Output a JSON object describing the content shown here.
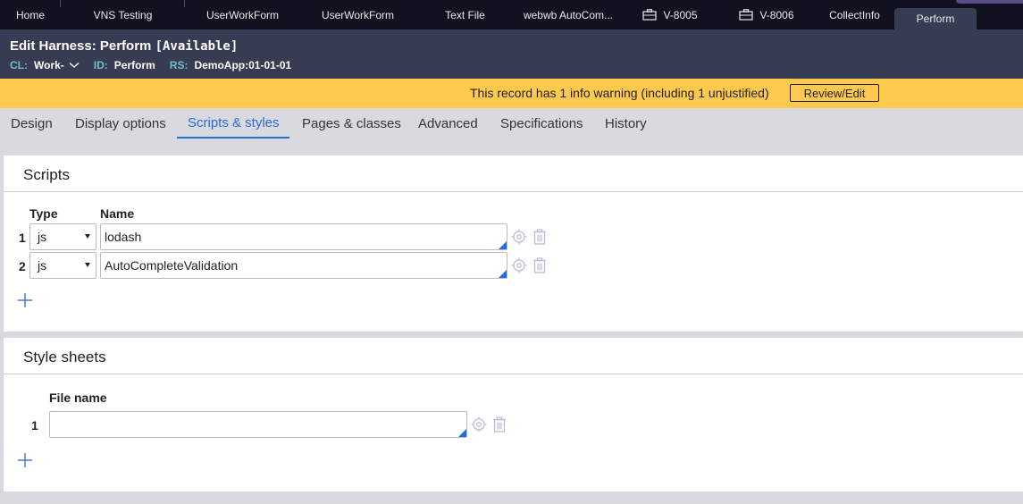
{
  "top_tabs": [
    {
      "label": "Home"
    },
    {
      "label": "VNS Testing"
    },
    {
      "label": "UserWorkForm"
    },
    {
      "label": "UserWorkForm"
    },
    {
      "label": "Text File"
    },
    {
      "label": "webwb AutoCom..."
    },
    {
      "label": "V-8005",
      "icon": "briefcase-icon"
    },
    {
      "label": "V-8006",
      "icon": "briefcase-icon"
    },
    {
      "label": "CollectInfo"
    },
    {
      "label": "Perform",
      "active": true
    }
  ],
  "header": {
    "title": "Edit  Harness: Perform",
    "status": "[Available]",
    "cl_key": "CL:",
    "cl_value": "Work-",
    "id_key": "ID:",
    "id_value": "Perform",
    "rs_key": "RS:",
    "rs_value": "DemoApp:01-01-01"
  },
  "warning": {
    "message": "This record has 1 info warning (including 1 unjustified)",
    "button": "Review/Edit"
  },
  "subtabs": [
    {
      "label": "Design"
    },
    {
      "label": "Display options"
    },
    {
      "label": "Scripts & styles",
      "active": true
    },
    {
      "label": "Pages & classes"
    },
    {
      "label": "Advanced"
    },
    {
      "label": "Specifications"
    },
    {
      "label": "History"
    }
  ],
  "scripts": {
    "title": "Scripts",
    "col_type": "Type",
    "col_name": "Name",
    "rows": [
      {
        "num": "1",
        "type": "js",
        "name": "lodash"
      },
      {
        "num": "2",
        "type": "js",
        "name": "AutoCompleteValidation"
      }
    ]
  },
  "stylesheets": {
    "title": "Style sheets",
    "col_file": "File name",
    "rows": [
      {
        "num": "1",
        "file": ""
      }
    ]
  },
  "colors": {
    "top_bar": "#10131f",
    "header": "#383c52",
    "warning": "#ffc94f",
    "accent": "#2a6ad4"
  }
}
